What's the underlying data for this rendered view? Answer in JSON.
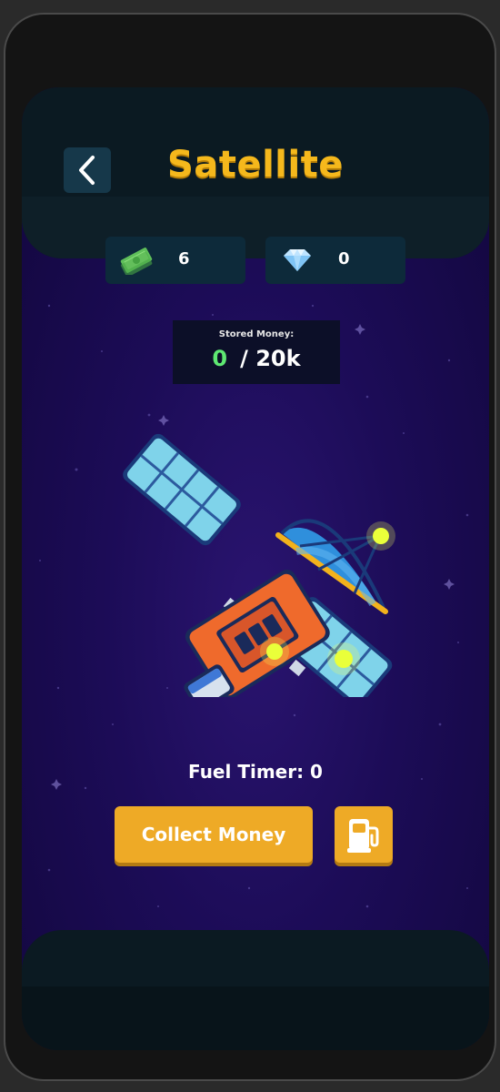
{
  "header": {
    "title": "Satellite",
    "back_icon": "chevron-left-icon"
  },
  "resources": {
    "money": {
      "icon": "cash-icon",
      "value": "6"
    },
    "gems": {
      "icon": "diamond-icon",
      "value": "0"
    }
  },
  "stored_money": {
    "label": "Stored Money:",
    "current": "0",
    "capacity": "/ 20k"
  },
  "fuel_timer": {
    "label": "Fuel Timer: 0"
  },
  "actions": {
    "collect_label": "Collect Money",
    "fuel_icon": "fuel-pump-icon"
  },
  "colors": {
    "accent": "#eeaa26",
    "title": "#f5b81c",
    "stored_current": "#5ee872",
    "background": "#1c0c57"
  }
}
